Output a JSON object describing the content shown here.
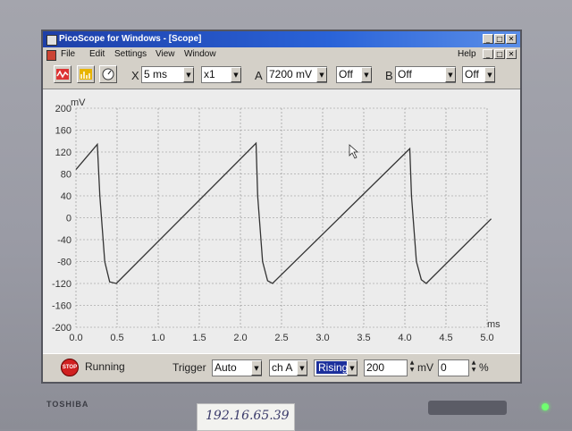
{
  "window": {
    "title": "PicoScope for Windows - [Scope]"
  },
  "menu": {
    "items": [
      "File",
      "Edit",
      "Settings",
      "View",
      "Window"
    ],
    "help": "Help"
  },
  "toolbar": {
    "x_label": "X",
    "timebase": "5 ms",
    "multiplier": "x1",
    "a_label": "A",
    "ch_a_range": "7200 mV",
    "ch_a_coupling": "Off",
    "b_label": "B",
    "ch_b_range": "Off",
    "ch_b_coupling": "Off"
  },
  "statusbar": {
    "state": "Running",
    "trigger_label": "Trigger",
    "trigger_mode": "Auto",
    "trigger_channel": "ch A",
    "trigger_edge": "Rising",
    "trigger_level": "200",
    "level_unit": "mV",
    "delay": "0",
    "delay_unit": "%"
  },
  "bezel": {
    "brand": "TOSHIBA",
    "sticker": "192.16.65.39"
  },
  "colors": {
    "trace": "#333333",
    "grid": "#8a8a8a",
    "plot_bg": "#ececec",
    "title_bar": "#2a63d8"
  },
  "chart_data": {
    "type": "line",
    "ylabel": "mV",
    "xlabel": "ms",
    "xlim": [
      0,
      5.0
    ],
    "ylim": [
      -200,
      200
    ],
    "x_ticks": [
      "0.0",
      "0.5",
      "1.0",
      "1.5",
      "2.0",
      "2.5",
      "3.0",
      "3.5",
      "4.0",
      "4.5",
      "5.0"
    ],
    "y_ticks": [
      "200",
      "160",
      "120",
      "80",
      "40",
      "0",
      "-40",
      "-80",
      "-120",
      "-160",
      "-200"
    ],
    "grid": true,
    "series": [
      {
        "x": [
          0.0,
          0.26,
          0.29,
          0.35,
          0.41,
          0.49,
          2.19,
          2.21,
          2.27,
          2.33,
          2.39,
          4.06,
          4.08,
          4.14,
          4.2,
          4.26,
          5.05
        ],
        "y": [
          88,
          134,
          40,
          -80,
          -117,
          -120,
          136,
          40,
          -80,
          -115,
          -120,
          126,
          40,
          -80,
          -113,
          -120,
          -2
        ]
      }
    ]
  }
}
